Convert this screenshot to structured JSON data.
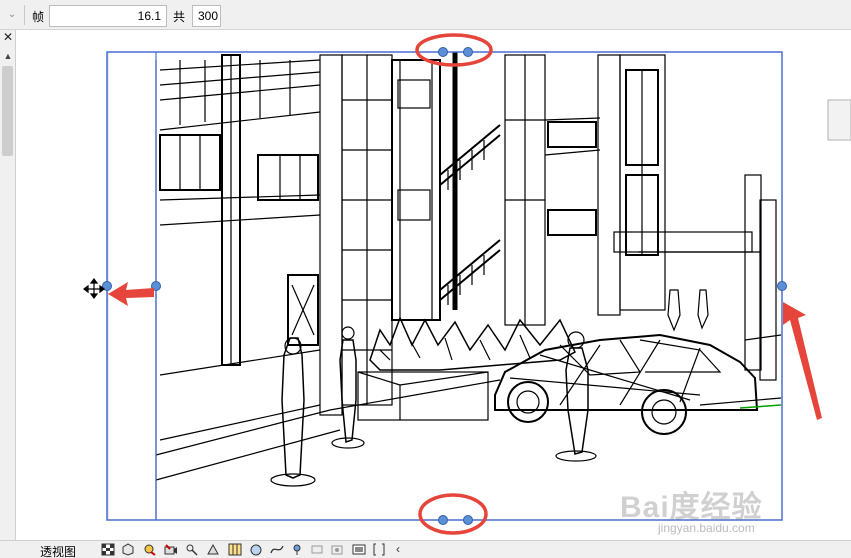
{
  "toolbar": {
    "frame_label": "帧",
    "frame_value": "16.1",
    "total_label": "共",
    "total_value": "300"
  },
  "view": {
    "label": "透视图"
  },
  "watermark": {
    "logo": "Bai度经验",
    "url": "jingyan.baidu.com"
  },
  "colors": {
    "frame_border": "#4a6fd0",
    "handle": "#5b8fd6",
    "annotation": "#e5453a"
  },
  "icons": [
    "chevron-down-icon",
    "close-icon",
    "scroll-up-icon",
    "move-cursor-icon",
    "arrow-icon"
  ]
}
